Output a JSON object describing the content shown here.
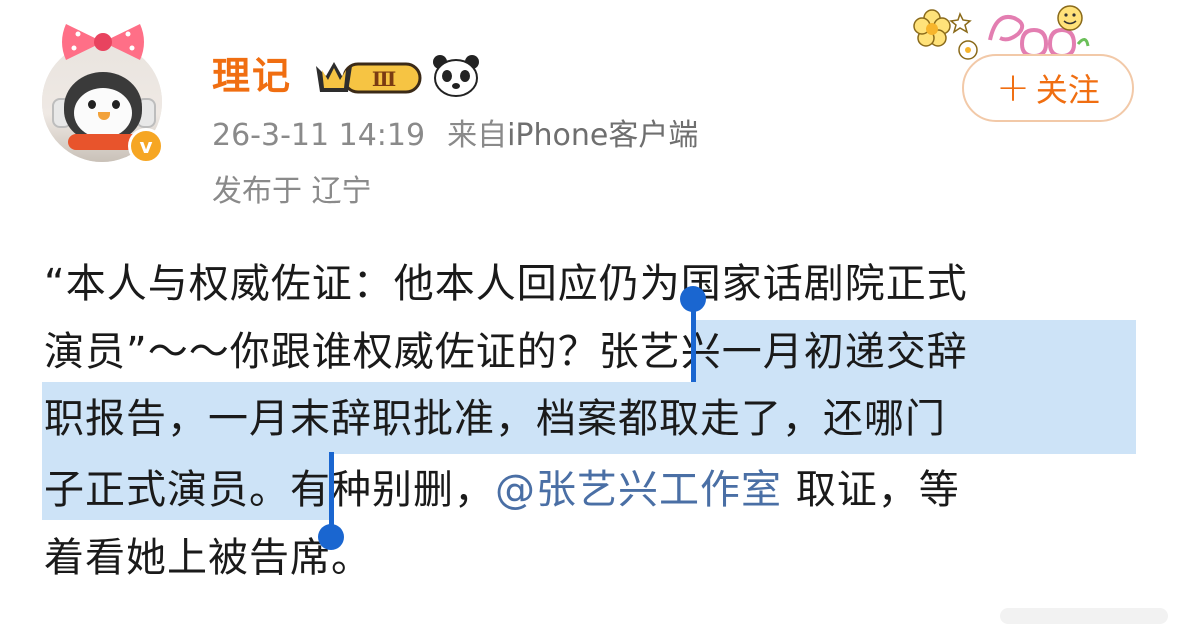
{
  "user": {
    "name": "理记",
    "vip_level": "Ⅲ",
    "verified_mark": "v"
  },
  "meta": {
    "timestamp": "26-3-11 14:19",
    "source_prefix": "来自",
    "source_app": "iPhone客户端",
    "location": "发布于 辽宁"
  },
  "follow": {
    "plus": "+",
    "label": "关注"
  },
  "post": {
    "line1": "“本人与权威佐证：他本人回应仍为国家话剧院正式",
    "line2_a": "演员”～～你跟谁权威佐证的？",
    "line2_b": "张艺兴一月初递交辞",
    "line3": "职报告，一月末辞职批准，档案都取走了，还哪门",
    "line4_a": "子正式演员。",
    "line4_b": "有种别删，",
    "line4_mention": "@张艺兴工作室",
    "line4_c": " 取证，等",
    "line5": "着看她上被告席。"
  },
  "colors": {
    "name": "#f06e11",
    "meta": "#8a8a8a",
    "highlight": "#cde3f7",
    "selection_handle": "#1a66d0",
    "mention": "#4a6fa5"
  },
  "icons": {
    "vip": "crown-vip-badge-icon",
    "panda": "panda-icon",
    "verified": "verified-badge-icon",
    "deco": "flower-sticker-icon"
  }
}
